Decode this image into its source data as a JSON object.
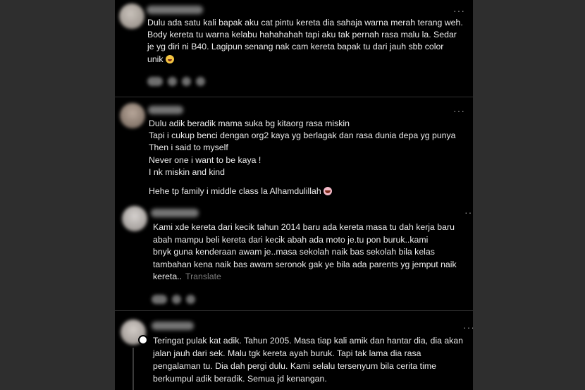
{
  "posts": [
    {
      "id": "post-1",
      "lines": [
        "Dulu ada satu kali bapak aku cat pintu kereta dia sahaja warna merah terang weh.",
        "Body kereta tu warna kelabu hahahahah tapi aku tak pernah rasa malu la. Sedar",
        "je yg diri ni B40. Lagipun senang nak cam kereta bapak tu dari jauh sbb color",
        "unik"
      ],
      "emoji": "rolling-laughing-emoji"
    },
    {
      "id": "post-2",
      "lines": [
        "Dulu adik beradik mama suka bg kitaorg rasa miskin",
        "Tapi i cukup benci dengan org2 kaya yg berlagak dan rasa dunia depa yg punya",
        "Then i said to myself",
        "Never one i want to be kaya !",
        "I nk miskin and kind"
      ],
      "extra": "Hehe tp family i middle class la Alhamdulillah",
      "emoji": "grinning-face-emoji"
    },
    {
      "id": "post-3",
      "lines": [
        "Kami xde kereta dari kecik tahun 2014 baru ada kereta masa tu dah kerja baru",
        "abah mampu beli kereta dari kecik abah ada moto je.tu pon buruk..kami",
        "bnyk guna kenderaan awam je..masa sekolah naik bas sekolah bila kelas",
        "tambahan kena naik bas awam seronok gak ye bila ada parents yg jemput naik",
        "kereta.."
      ],
      "translate": "Translate"
    },
    {
      "id": "post-4",
      "lines": [
        "Teringat pulak kat adik. Tahun 2005. Masa tiap kali amik dan hantar dia, dia akan",
        "jalan jauh dari sek. Malu tgk kereta ayah buruk. Tapi tak lama dia rasa",
        "pengalaman tu. Dia dah pergi dulu. Kami selalu tersenyum bila cerita time",
        "berkumpul adik beradik. Semua jd kenangan."
      ]
    }
  ],
  "more_glyph": "···",
  "colors": {
    "background": "#2e2e2e",
    "feed": "#000000",
    "text": "#ececec",
    "muted": "#7d7d7d"
  }
}
